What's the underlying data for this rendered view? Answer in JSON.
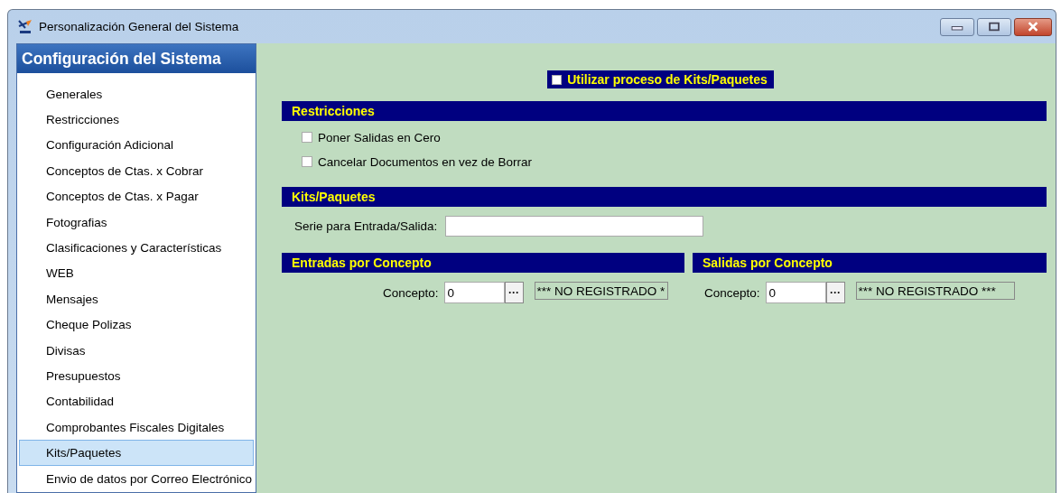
{
  "window": {
    "title": "Personalización General del Sistema"
  },
  "sidebar": {
    "title": "Configuración del Sistema",
    "items": [
      {
        "label": "Generales",
        "selected": false
      },
      {
        "label": "Restricciones",
        "selected": false
      },
      {
        "label": "Configuración Adicional",
        "selected": false
      },
      {
        "label": "Conceptos de Ctas. x Cobrar",
        "selected": false
      },
      {
        "label": "Conceptos de Ctas. x Pagar",
        "selected": false
      },
      {
        "label": "Fotografias",
        "selected": false
      },
      {
        "label": "Clasificaciones y Características",
        "selected": false
      },
      {
        "label": "WEB",
        "selected": false
      },
      {
        "label": "Mensajes",
        "selected": false
      },
      {
        "label": "Cheque Polizas",
        "selected": false
      },
      {
        "label": "Divisas",
        "selected": false
      },
      {
        "label": "Presupuestos",
        "selected": false
      },
      {
        "label": "Contabilidad",
        "selected": false
      },
      {
        "label": "Comprobantes Fiscales Digitales",
        "selected": false
      },
      {
        "label": "Kits/Paquetes",
        "selected": true
      },
      {
        "label": "Envio de datos por Correo Electrónico",
        "selected": false
      }
    ]
  },
  "main": {
    "kits_option": {
      "label": "Utilizar proceso de Kits/Paquetes",
      "checked": false
    },
    "restricciones": {
      "title": "Restricciones",
      "options": [
        {
          "label": "Poner Salidas en Cero",
          "checked": false
        },
        {
          "label": "Cancelar Documentos en vez de Borrar",
          "checked": false
        }
      ]
    },
    "kits": {
      "title": "Kits/Paquetes",
      "serie_label": "Serie para Entrada/Salida:"
    },
    "conceptos": [
      {
        "title": "Entradas por Concepto",
        "label": "Concepto:",
        "value": "0",
        "browse": "···",
        "status": "*** NO REGISTRADO *"
      },
      {
        "title": "Salidas por Concepto",
        "label": "Concepto:",
        "value": "0",
        "browse": "···",
        "status": "*** NO REGISTRADO ***"
      }
    ]
  }
}
